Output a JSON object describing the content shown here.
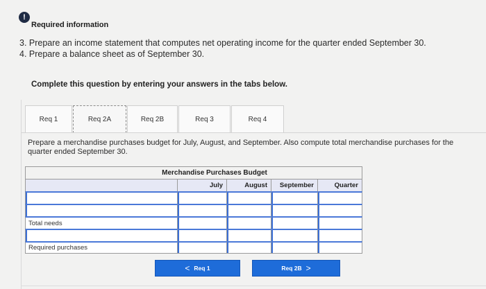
{
  "header": {
    "info_icon_glyph": "!",
    "required_info": "Required information"
  },
  "instructions": [
    "3. Prepare an income statement that computes net operating income for the quarter ended September 30.",
    "4. Prepare a balance sheet as of September 30."
  ],
  "complete_prompt": "Complete this question by entering your answers in the tabs below.",
  "tabs": [
    {
      "label": "Req 1"
    },
    {
      "label": "Req 2A"
    },
    {
      "label": "Req 2B"
    },
    {
      "label": "Req 3"
    },
    {
      "label": "Req 4"
    }
  ],
  "prompt": "Prepare a merchandise purchases budget for July, August, and September. Also compute total merchandise purchases for the quarter ended September 30.",
  "budget": {
    "title": "Merchandise Purchases Budget",
    "columns": [
      "July",
      "August",
      "September",
      "Quarter"
    ],
    "row_labels": {
      "total_needs": "Total needs",
      "required_purchases": "Required purchases"
    }
  },
  "nav": {
    "prev_label": "Req 1",
    "next_label": "Req 2B",
    "prev_glyph": "<",
    "next_glyph": ">"
  },
  "colors": {
    "accent": "#1e6cd9",
    "header_fill": "#e6e8f5"
  }
}
